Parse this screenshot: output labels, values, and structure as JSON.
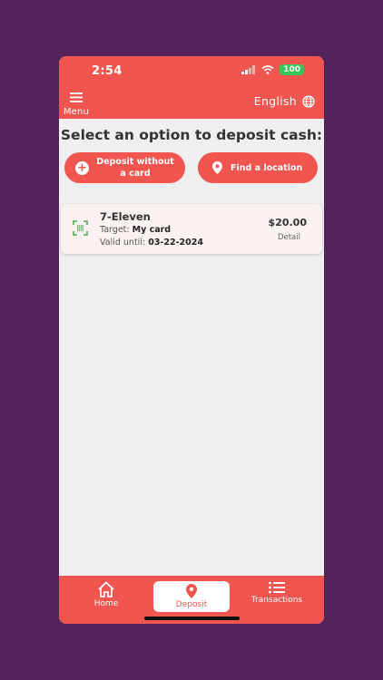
{
  "status": {
    "time": "2:54",
    "battery": "100"
  },
  "header": {
    "menu_label": "Menu",
    "language": "English"
  },
  "main": {
    "title": "Select an option to deposit cash:",
    "actions": {
      "deposit_without_card": "Deposit without a card",
      "find_location": "Find a location"
    },
    "deposits": [
      {
        "store": "7-Eleven",
        "target_label": "Target:",
        "target_value": "My card",
        "valid_label": "Valid until:",
        "valid_value": "03-22-2024",
        "amount": "$20.00",
        "detail_label": "Detail"
      }
    ]
  },
  "tabs": {
    "home": "Home",
    "deposit": "Deposit",
    "transactions": "Transactions"
  },
  "colors": {
    "brand": "#f0564f",
    "background": "#54235c",
    "screen": "#efefef",
    "battery": "#34c759",
    "barcode": "#4caf50"
  }
}
